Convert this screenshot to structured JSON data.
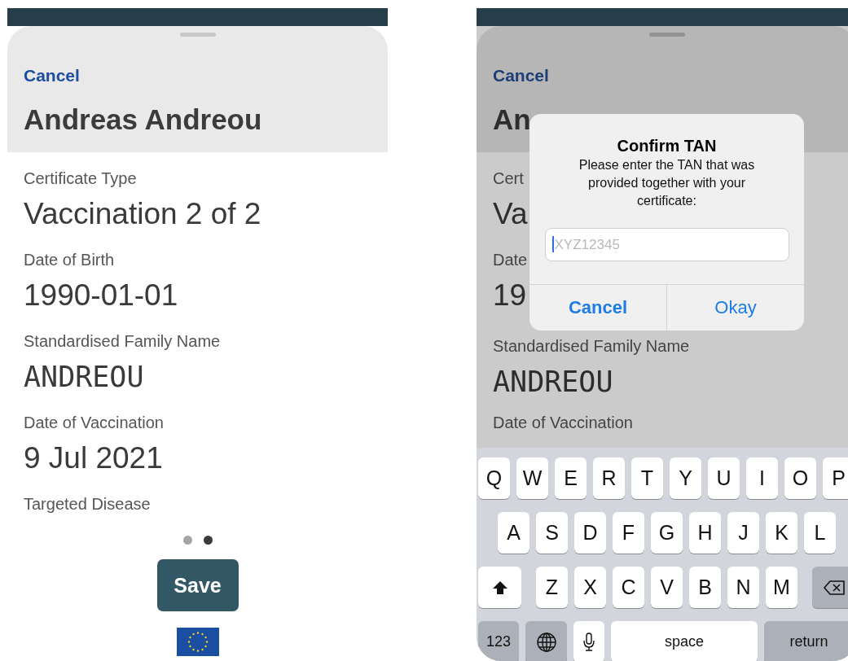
{
  "left_screen": {
    "dimmed": false,
    "sheet": {
      "cancel": "Cancel",
      "title": "Andreas Andreou",
      "fields": [
        {
          "label": "Certificate Type",
          "value": "Vaccination 2 of 2",
          "kind": "plain"
        },
        {
          "label": "Date of Birth",
          "value": "1990-01-01",
          "kind": "plain"
        },
        {
          "label": "Standardised Family Name",
          "value": "ANDREOU",
          "kind": "mono"
        },
        {
          "label": "Date of Vaccination",
          "value": "9 Jul 2021",
          "kind": "plain"
        },
        {
          "label": "Targeted Disease"
        }
      ]
    },
    "pages": [
      {
        "selected": false
      },
      {
        "selected": true
      }
    ],
    "save_button": "Save"
  },
  "right_screen": {
    "dimmed": true,
    "sheet": {
      "cancel": "Cancel",
      "title": "An",
      "fields": [
        {
          "label": "Cert",
          "value": "Va",
          "kind": "plain"
        },
        {
          "label": "Date",
          "value": "19",
          "kind": "plain"
        },
        {
          "label": "Standardised Family Name",
          "value": "ANDREOU",
          "kind": "mono"
        },
        {
          "label": "Date of Vaccination"
        }
      ]
    },
    "dialog": {
      "title": "Confirm TAN",
      "message": "Please enter the TAN that was provided together with your certificate:",
      "field": {
        "placeholder": "XYZ12345",
        "focused": true
      },
      "buttons": [
        {
          "label": "Cancel",
          "default": true
        },
        {
          "label": "Okay",
          "default": false
        }
      ]
    },
    "keyboard": {
      "top_row": [
        {
          "kind": "letter",
          "label": "Q"
        },
        {
          "kind": "letter",
          "label": "W"
        },
        {
          "kind": "letter",
          "label": "E"
        },
        {
          "kind": "letter",
          "label": "R"
        },
        {
          "kind": "letter",
          "label": "T"
        },
        {
          "kind": "letter",
          "label": "Y"
        },
        {
          "kind": "letter",
          "label": "U"
        },
        {
          "kind": "letter",
          "label": "I"
        },
        {
          "kind": "letter",
          "label": "O"
        },
        {
          "kind": "letter",
          "label": "P"
        }
      ],
      "middle_row": [
        {
          "kind": "letter",
          "label": "A"
        },
        {
          "kind": "letter",
          "label": "S"
        },
        {
          "kind": "letter",
          "label": "D"
        },
        {
          "kind": "letter",
          "label": "F"
        },
        {
          "kind": "letter",
          "label": "G"
        },
        {
          "kind": "letter",
          "label": "H"
        },
        {
          "kind": "letter",
          "label": "J"
        },
        {
          "kind": "letter",
          "label": "K"
        },
        {
          "kind": "letter",
          "label": "L"
        }
      ],
      "bottom_row": [
        {
          "kind": "shift"
        },
        {
          "kind": "letter",
          "label": "Z"
        },
        {
          "kind": "letter",
          "label": "X"
        },
        {
          "kind": "letter",
          "label": "C"
        },
        {
          "kind": "letter",
          "label": "V"
        },
        {
          "kind": "letter",
          "label": "B"
        },
        {
          "kind": "letter",
          "label": "N"
        },
        {
          "kind": "letter",
          "label": "M"
        },
        {
          "kind": "delete"
        }
      ],
      "function_row": [
        {
          "kind": "numbers",
          "label": "123"
        },
        {
          "kind": "globe"
        },
        {
          "kind": "mic"
        },
        {
          "kind": "space",
          "label": "space"
        },
        {
          "kind": "return",
          "label": "return"
        }
      ]
    }
  }
}
